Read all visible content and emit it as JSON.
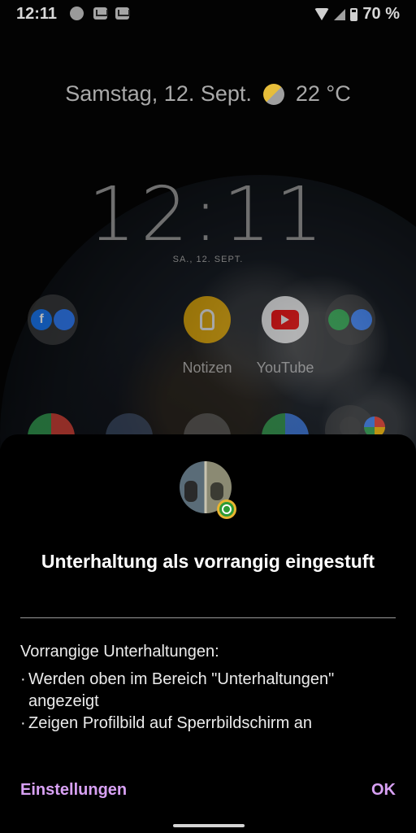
{
  "status_bar": {
    "time": "12:11",
    "battery": "70 %",
    "notification_icons": [
      "vpn-icon",
      "gmail-icon",
      "gmail-icon"
    ]
  },
  "lockscreen": {
    "date_weather": "Samstag, 12. Sept.",
    "temperature": "22 °C",
    "clock": "12:11",
    "small_date": "SA., 12. SEPT."
  },
  "home_apps": [
    {
      "label": "Notizen",
      "icon": "keep-notes-icon",
      "color": "#f4b400"
    },
    {
      "label": "YouTube",
      "icon": "youtube-icon",
      "color": "#ff0000"
    }
  ],
  "dialog": {
    "title": "Unterhaltung als vorrangig eingestuft",
    "intro": "Vorrangige Unterhaltungen:",
    "bullets": [
      "Werden oben im Bereich \"Unterhaltungen\" angezeigt",
      "Zeigen Profilbild auf Sperrbildschirm an"
    ],
    "settings_button": "Einstellungen",
    "ok_button": "OK",
    "badge_icon": "whatsapp-icon"
  },
  "colors": {
    "accent": "#d8a1f4",
    "sheet_background": "#000000"
  }
}
